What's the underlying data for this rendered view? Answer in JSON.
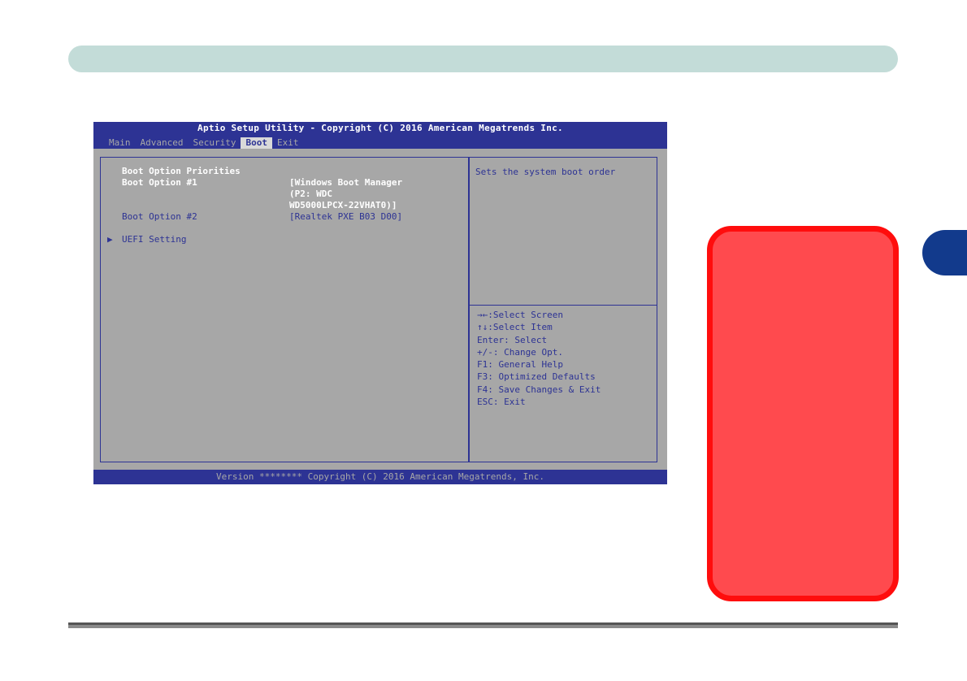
{
  "bios": {
    "title": "Aptio Setup Utility - Copyright (C) 2016 American Megatrends Inc.",
    "tabs": [
      "Main",
      "Advanced",
      "Security",
      "Boot",
      "Exit"
    ],
    "active_tab": "Boot",
    "main": {
      "section_heading": "Boot Option Priorities",
      "option1_label": "Boot Option #1",
      "option1_value_line1": "[Windows Boot Manager",
      "option1_value_line2": "(P2: WDC",
      "option1_value_line3": "WD5000LPCX-22VHAT0)]",
      "option2_label": "Boot Option #2",
      "option2_value": "[Realtek PXE B03 D00]",
      "submenu_label": "UEFI Setting"
    },
    "help": {
      "description": "Sets the system boot order",
      "keys": [
        ":Select Screen",
        ":Select Item",
        "Enter: Select",
        "+/-: Change Opt.",
        "F1: General Help",
        "F3: Optimized Defaults",
        "F4: Save Changes & Exit",
        "ESC: Exit"
      ]
    },
    "footer": "Version ******** Copyright (C) 2016 American Megatrends, Inc."
  },
  "colors": {
    "bios_blue": "#2d3394",
    "bios_gray": "#a7a7a7",
    "header_bar": "#c3dcd8",
    "chapter_tab": "#123a8c",
    "red_note_fill": "#ff4a4e",
    "red_note_border": "#ff0d0d"
  },
  "icons": {
    "key1": "left-right-arrows-icon",
    "key2": "up-down-arrows-icon",
    "submenu": "triangle-right-icon"
  }
}
